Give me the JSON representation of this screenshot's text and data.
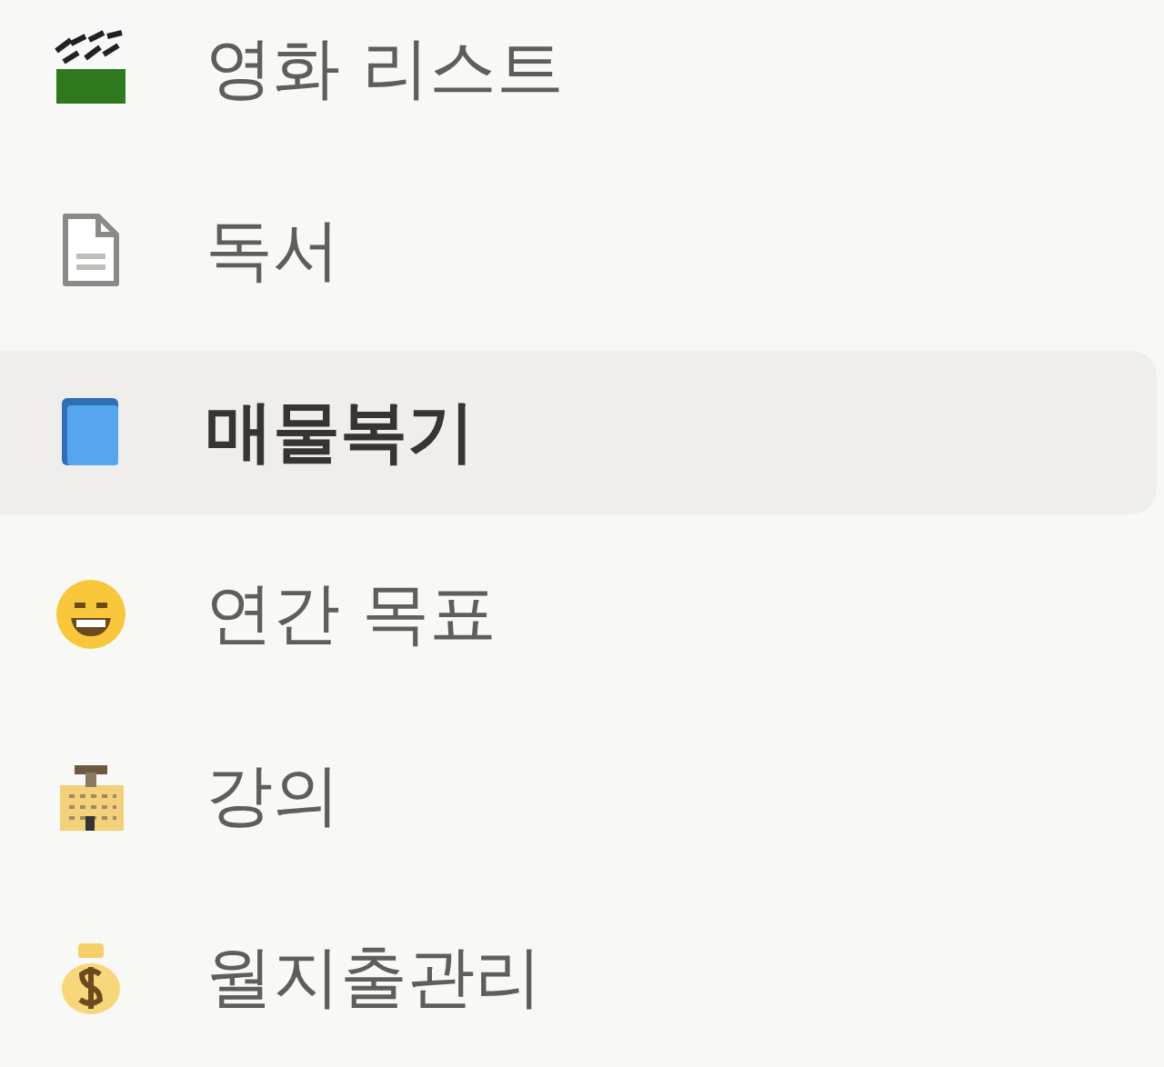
{
  "sidebar": {
    "items": [
      {
        "label": "영화 리스트",
        "selected": false,
        "kind": "clapper"
      },
      {
        "label": "독서",
        "selected": false,
        "kind": "page"
      },
      {
        "label": "매물복기",
        "selected": true,
        "kind": "book"
      },
      {
        "label": "연간 목표",
        "selected": false,
        "kind": "grin"
      },
      {
        "label": "강의",
        "selected": false,
        "kind": "building"
      },
      {
        "label": "월지출관리",
        "selected": false,
        "kind": "moneybag"
      }
    ]
  }
}
